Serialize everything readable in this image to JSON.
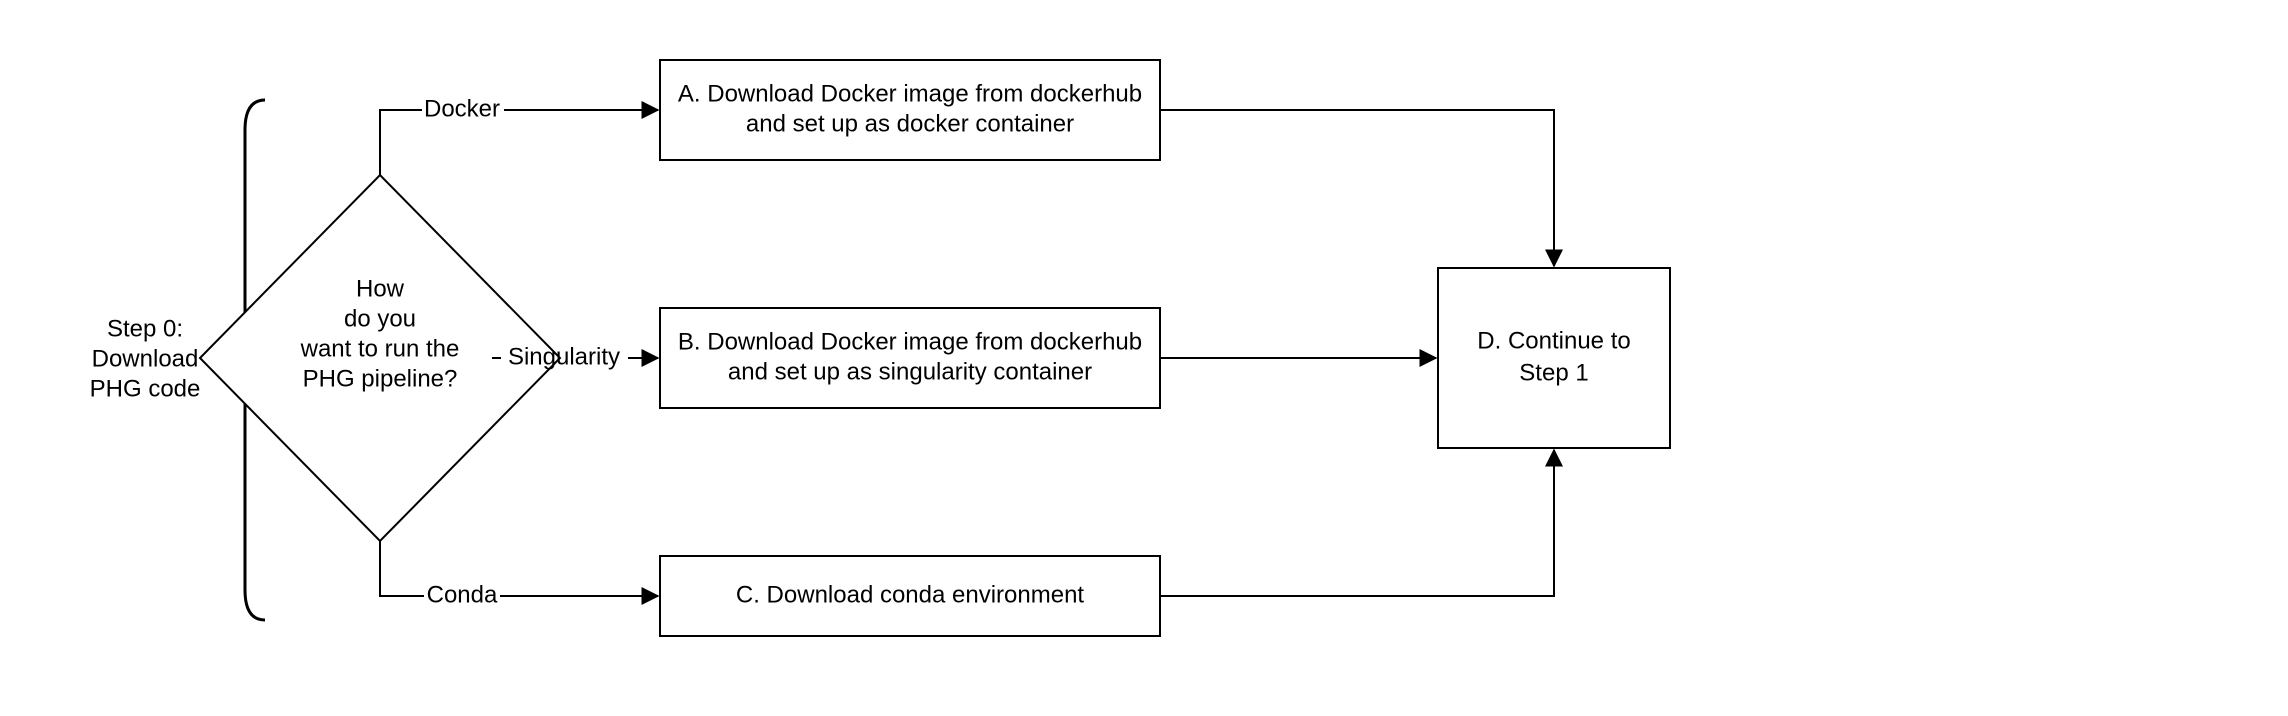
{
  "title": {
    "line1": "Step 0:",
    "line2": "Download",
    "line3": "PHG code"
  },
  "decision": {
    "line1": "How",
    "line2": "do you",
    "line3": "want to run the",
    "line4": "PHG pipeline?"
  },
  "edges": {
    "docker": "Docker",
    "singularity": "Singularity",
    "conda": "Conda"
  },
  "nodeA": {
    "line1": "A. Download Docker image from dockerhub",
    "line2": "and set up as docker container"
  },
  "nodeB": {
    "line1": "B. Download Docker image from dockerhub",
    "line2": "and set up as singularity container"
  },
  "nodeC": {
    "line1": "C. Download conda environment"
  },
  "nodeD": {
    "line1": "D. Continue to",
    "line2": "Step 1"
  }
}
